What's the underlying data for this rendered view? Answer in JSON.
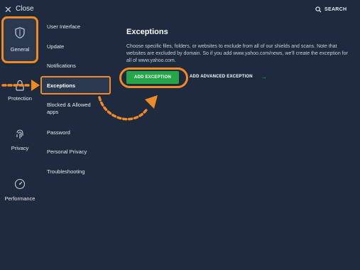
{
  "header": {
    "close_icon": "close-icon",
    "close_label": "Close",
    "search_icon": "search-icon",
    "search_label": "SEARCH"
  },
  "categories": [
    {
      "label": "General",
      "icon": "shield-icon",
      "active": true
    },
    {
      "label": "Protection",
      "icon": "lock-icon",
      "active": false
    },
    {
      "label": "Privacy",
      "icon": "fingerprint-icon",
      "active": false
    },
    {
      "label": "Performance",
      "icon": "speedometer-icon",
      "active": false
    }
  ],
  "submenu": [
    {
      "label": "User Interface",
      "active": false
    },
    {
      "label": "Update",
      "active": false
    },
    {
      "label": "Notifications",
      "active": false
    },
    {
      "label": "Exceptions",
      "active": true
    },
    {
      "label": "Blocked & Allowed apps",
      "active": false
    },
    {
      "label": "Password",
      "active": false
    },
    {
      "label": "Personal Privacy",
      "active": false
    },
    {
      "label": "Troubleshooting",
      "active": false
    }
  ],
  "main": {
    "title": "Exceptions",
    "description": "Choose specific files, folders, or websites to exclude from all of our shields and scans. Note that websites are excluded by domain. So if you add www.yahoo.com/news, we'll create the exception for all of www.yahoo.com.",
    "add_exception_label": "ADD EXCEPTION",
    "add_advanced_label": "ADD ADVANCED EXCEPTION",
    "arrow_icon": "arrow-right-icon"
  },
  "colors": {
    "background": "#1e2a3e",
    "highlight": "#f18a22",
    "button_green": "#27a54a",
    "text": "#e6e9ef"
  }
}
